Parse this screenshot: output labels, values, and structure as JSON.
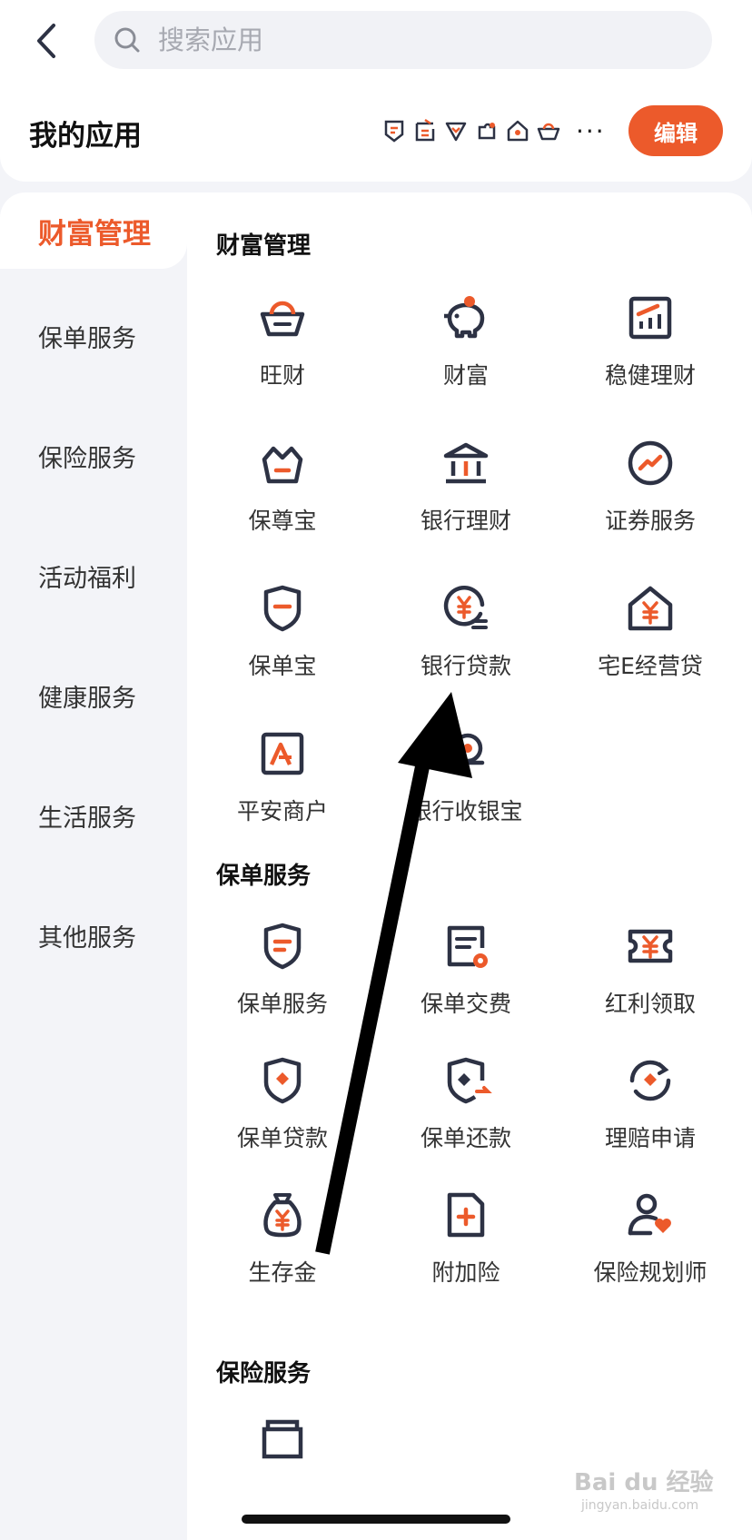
{
  "header": {
    "search_placeholder": "搜索应用"
  },
  "my_apps": {
    "title": "我的应用",
    "more": "···",
    "edit_label": "编辑"
  },
  "sidebar": {
    "items": [
      {
        "label": "财富管理",
        "active": true
      },
      {
        "label": "保单服务",
        "active": false
      },
      {
        "label": "保险服务",
        "active": false
      },
      {
        "label": "活动福利",
        "active": false
      },
      {
        "label": "健康服务",
        "active": false
      },
      {
        "label": "生活服务",
        "active": false
      },
      {
        "label": "其他服务",
        "active": false
      }
    ]
  },
  "sections": [
    {
      "title": "财富管理",
      "apps": [
        {
          "label": "旺财",
          "icon": "gold-ingot-icon"
        },
        {
          "label": "财富",
          "icon": "piggy-bank-icon"
        },
        {
          "label": "稳健理财",
          "icon": "growth-chart-icon"
        },
        {
          "label": "保尊宝",
          "icon": "crown-basket-icon"
        },
        {
          "label": "银行理财",
          "icon": "bank-building-icon"
        },
        {
          "label": "证券服务",
          "icon": "trend-circle-icon"
        },
        {
          "label": "保单宝",
          "icon": "shield-minus-icon"
        },
        {
          "label": "银行贷款",
          "icon": "yen-coin-icon"
        },
        {
          "label": "宅E经营贷",
          "icon": "yen-house-icon"
        },
        {
          "label": "平安商户",
          "icon": "merchant-a-icon"
        },
        {
          "label": "银行收银宝",
          "icon": "cashier-icon"
        }
      ]
    },
    {
      "title": "保单服务",
      "apps": [
        {
          "label": "保单服务",
          "icon": "shield-doc-icon"
        },
        {
          "label": "保单交费",
          "icon": "doc-payment-icon"
        },
        {
          "label": "红利领取",
          "icon": "yen-ticket-icon"
        },
        {
          "label": "保单贷款",
          "icon": "shield-diamond-icon"
        },
        {
          "label": "保单还款",
          "icon": "shield-return-icon"
        },
        {
          "label": "理赔申请",
          "icon": "claim-cycle-icon"
        },
        {
          "label": "生存金",
          "icon": "money-bag-icon"
        },
        {
          "label": "附加险",
          "icon": "doc-plus-icon"
        },
        {
          "label": "保险规划师",
          "icon": "planner-user-icon"
        }
      ]
    },
    {
      "title": "保险服务",
      "apps": []
    }
  ],
  "colors": {
    "accent": "#ec5a2b",
    "icon_dark": "#2d3244",
    "sidebar_bg": "#f3f4f8"
  },
  "watermark": {
    "brand": "Bai du 经验",
    "url": "jingyan.baidu.com"
  }
}
